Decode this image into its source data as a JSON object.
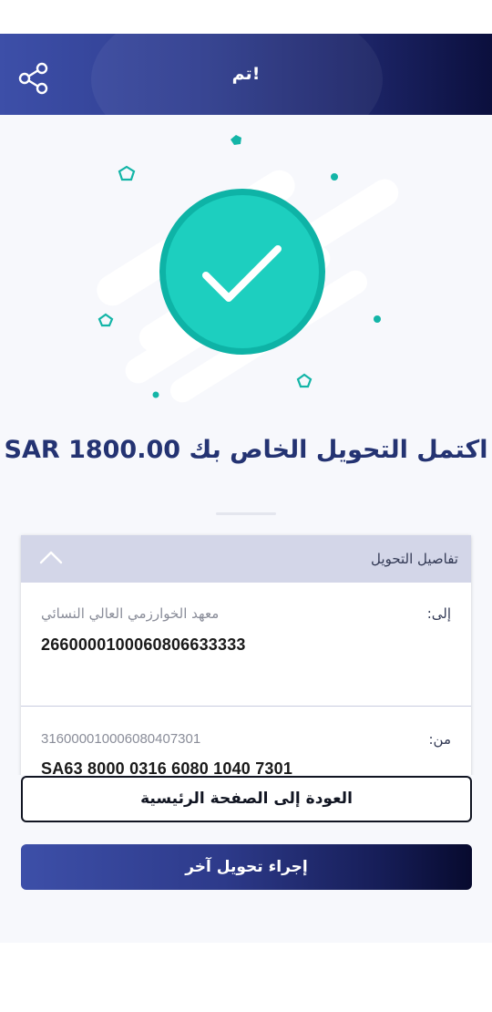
{
  "header": {
    "title": "تم!",
    "share_icon": "share-icon",
    "gradient_start": "#3d4fa8",
    "gradient_end": "#0b0f3d"
  },
  "success": {
    "message": "اكتمل التحويل الخاص بك SAR 1800.00",
    "check_icon": "checkmark-circle-icon",
    "accent_color": "#1ccfbf"
  },
  "details": {
    "title": "تفاصيل التحويل",
    "collapse_icon": "chevron-up-icon",
    "to": {
      "label": "إلى:",
      "name": "معهد الخوارزمي العالي النسائي",
      "account": "2660000100060806633333"
    },
    "from": {
      "label": "من:",
      "account_number": "316000010006080407301",
      "iban": "SA63 8000 0316 6080 1040 7301"
    }
  },
  "actions": {
    "home_label": "العودة إلى الصفحة الرئيسية",
    "another_label": "إجراء تحويل آخر"
  }
}
